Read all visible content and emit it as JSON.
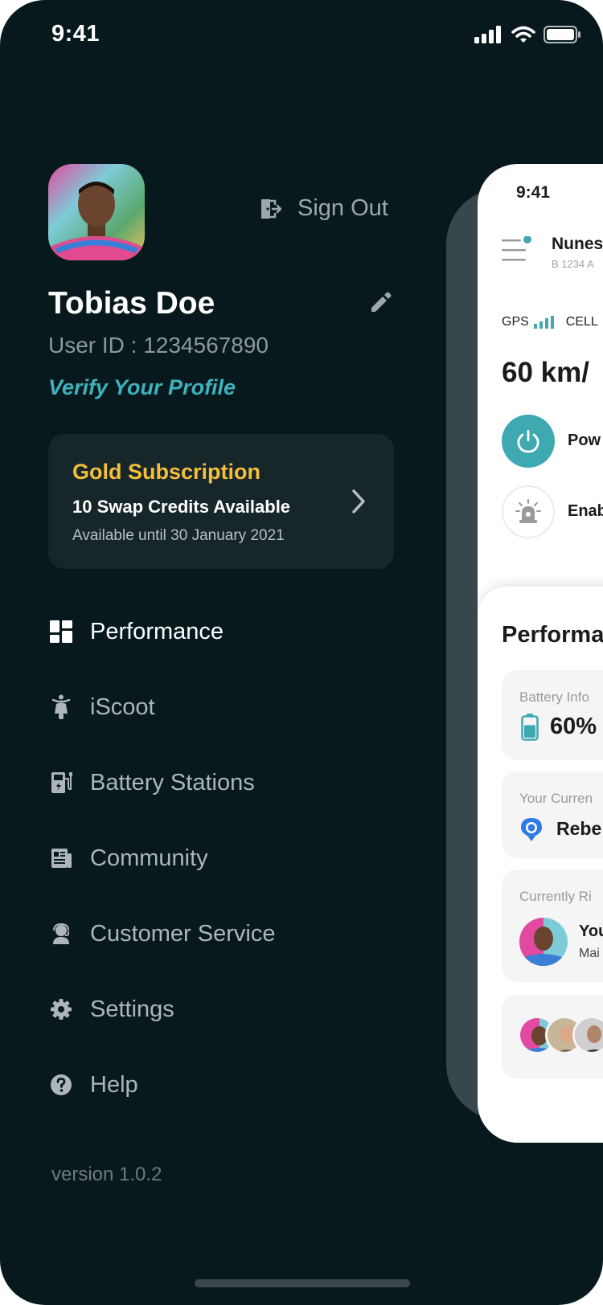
{
  "status_bar": {
    "time": "9:41"
  },
  "profile": {
    "sign_out_label": "Sign Out",
    "name": "Tobias Doe",
    "user_id": "User ID : 1234567890",
    "verify_label": "Verify Your Profile"
  },
  "subscription": {
    "title": "Gold Subscription",
    "credits": "10 Swap Credits Available",
    "until": "Available until 30 January 2021"
  },
  "menu": {
    "items": [
      {
        "label": "Performance",
        "icon": "dashboard-icon",
        "active": true
      },
      {
        "label": "iScoot",
        "icon": "scooter-icon",
        "active": false
      },
      {
        "label": "Battery Stations",
        "icon": "battery-station-icon",
        "active": false
      },
      {
        "label": "Community",
        "icon": "newspaper-icon",
        "active": false
      },
      {
        "label": "Customer Service",
        "icon": "headset-agent-icon",
        "active": false
      },
      {
        "label": "Settings",
        "icon": "gear-icon",
        "active": false
      },
      {
        "label": "Help",
        "icon": "help-circle-icon",
        "active": false
      }
    ]
  },
  "version": "version 1.0.2",
  "preview": {
    "time": "9:41",
    "vehicle_name": "Nunes",
    "vehicle_plate": "B 1234 A",
    "gps_label": "GPS",
    "cell_label": "CELL",
    "speed": "60 km/",
    "power_label": "Pow",
    "alarm_label": "Enab",
    "performance_title": "Performa",
    "battery_label": "Battery Info",
    "battery_value": "60%",
    "battery_level": 0.6,
    "location_label": "Your Curren",
    "location_value": "Rebe",
    "rider_label": "Currently Ri",
    "rider_name": "You",
    "rider_sub": "Mai"
  },
  "colors": {
    "background": "#08191e",
    "accent": "#3fb1bd",
    "gold": "#f3bf3a",
    "card": "#172629"
  }
}
